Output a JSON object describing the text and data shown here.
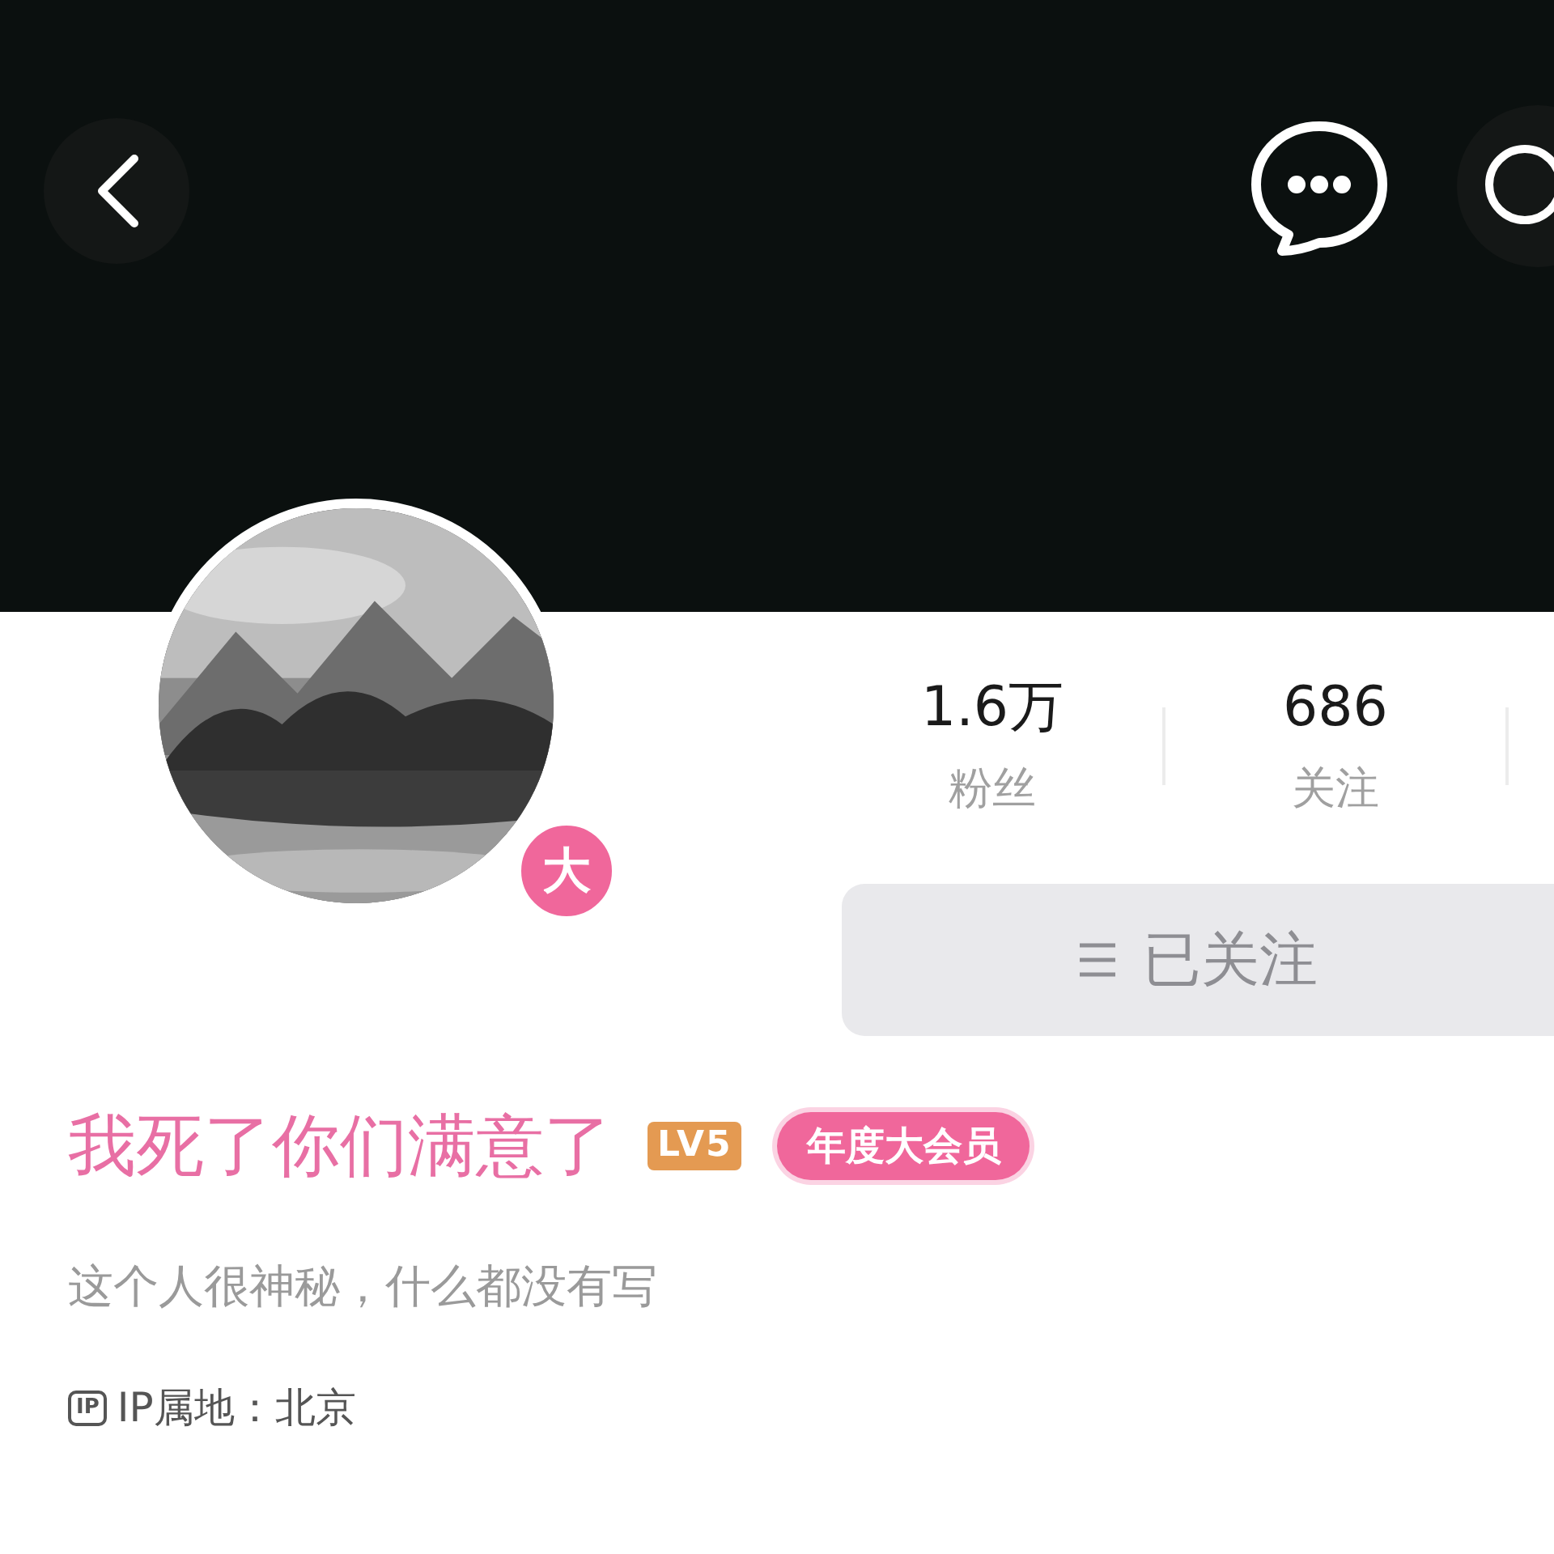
{
  "profile": {
    "avatar": {
      "badge": "大"
    },
    "stats": [
      {
        "value": "1.6万",
        "label": "粉丝"
      },
      {
        "value": "686",
        "label": "关注"
      }
    ],
    "follow_button": {
      "label": "已关注"
    },
    "name": "我死了你们满意了",
    "level": "LV5",
    "vip_badge": "年度大会员",
    "bio": "这个人很神秘，什么都没有写",
    "ip": {
      "icon": "IP",
      "text": "IP属地：北京"
    }
  }
}
